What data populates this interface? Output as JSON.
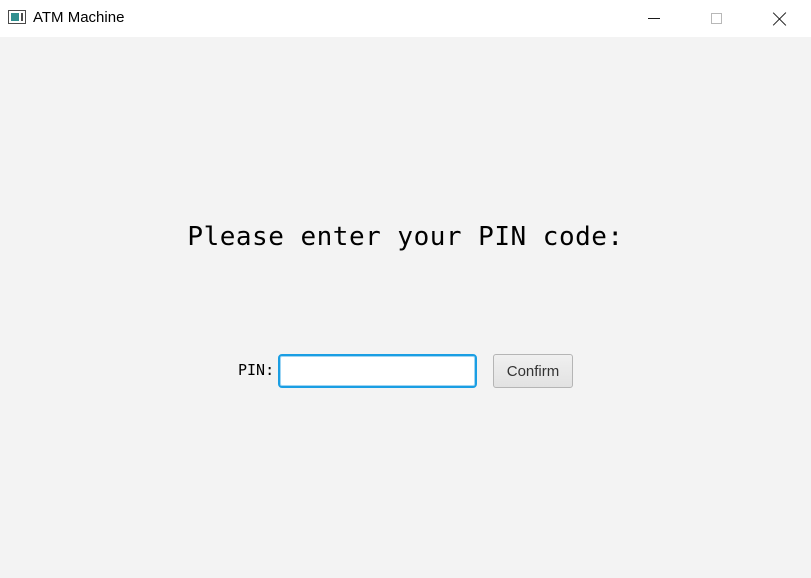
{
  "window": {
    "title": "ATM Machine",
    "icon": "app-window-icon",
    "controls": [
      "minimize-icon",
      "maximize-icon",
      "close-icon"
    ]
  },
  "main": {
    "prompt": "Please enter your PIN code:",
    "pin_label": "PIN:",
    "pin_value": "",
    "pin_placeholder": "",
    "confirm_label": "Confirm"
  },
  "colors": {
    "background": "#f3f3f3",
    "titlebar": "#ffffff",
    "input_focus_border": "#1a9ee3"
  }
}
